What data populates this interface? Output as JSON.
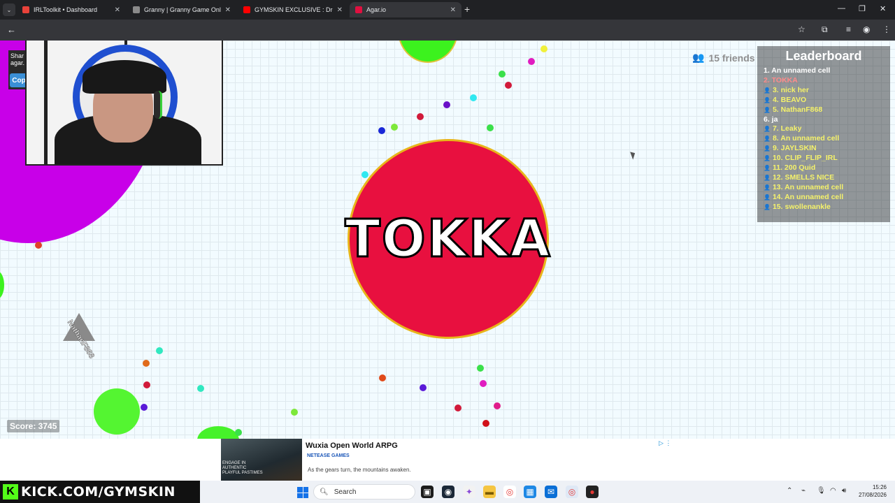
{
  "browser": {
    "tabs": [
      {
        "title": "IRLToolkit • Dashboard",
        "favicon_color": "#e8423a",
        "active": false
      },
      {
        "title": "Granny | Granny Game Online",
        "favicon_color": "#8a8a8a",
        "active": false
      },
      {
        "title": "GYMSKIN EXCLUSIVE : Droppin",
        "favicon_color": "#ff0000",
        "active": false
      },
      {
        "title": "Agar.io",
        "favicon_color": "#e01040",
        "active": true
      }
    ],
    "tab_close": "✕",
    "new_tab": "+",
    "window_controls": {
      "minimize": "—",
      "maximize": "❐",
      "close": "✕"
    },
    "nav": {
      "back": "←"
    },
    "toolbar_icons": [
      "star-icon",
      "extensions-icon",
      "media-icon",
      "profile-icon",
      "menu-icon"
    ]
  },
  "game": {
    "player_name": "TOKKA",
    "player_color": "#e8103f",
    "share_text": "Shar agar.",
    "copy_label": "Cop",
    "friends": "15 friends",
    "enemy_name": "NathanF868",
    "score": "Score: 3745",
    "leaderboard": {
      "title": "Leaderboard",
      "entries": [
        {
          "text": "1. An unnamed cell",
          "color": "#ffffff",
          "icon": false
        },
        {
          "text": "2. TOKKA",
          "color": "#ff8a8a",
          "icon": false
        },
        {
          "text": "3. nick her",
          "color": "#f5f26a",
          "icon": true
        },
        {
          "text": "4. BEAVO",
          "color": "#f5f26a",
          "icon": true
        },
        {
          "text": "5. NathanF868",
          "color": "#f5f26a",
          "icon": true
        },
        {
          "text": "6. ja",
          "color": "#ffffff",
          "icon": false
        },
        {
          "text": "7. Leaky",
          "color": "#f5f26a",
          "icon": true
        },
        {
          "text": "8. An unnamed cell",
          "color": "#f5f26a",
          "icon": true
        },
        {
          "text": "9. JAYLSKIN",
          "color": "#f5f26a",
          "icon": true
        },
        {
          "text": "10. CLIP_FLIP_IRL",
          "color": "#f5f26a",
          "icon": true
        },
        {
          "text": "11. 200 Quid",
          "color": "#f5f26a",
          "icon": true
        },
        {
          "text": "12. SMELLS NICE",
          "color": "#f5f26a",
          "icon": true
        },
        {
          "text": "13. An unnamed cell",
          "color": "#f5f26a",
          "icon": true
        },
        {
          "text": "14. An unnamed cell",
          "color": "#f5f26a",
          "icon": true
        },
        {
          "text": "15. swollenankle",
          "color": "#f5f26a",
          "icon": true
        }
      ]
    }
  },
  "ad": {
    "title": "Wuxia Open World ARPG",
    "brand": "NETEASE GAMES",
    "description": "As the gears turn, the mountains awaken.",
    "image_caption": "ENGAGE IN AUTHENTIC PLAYFUL PASTIMES"
  },
  "taskbar": {
    "banner": "KICK.COM/GYMSKIN",
    "banner_logo": "K",
    "search_placeholder": "Search",
    "time": "15:26",
    "date": "27/08/2026"
  }
}
